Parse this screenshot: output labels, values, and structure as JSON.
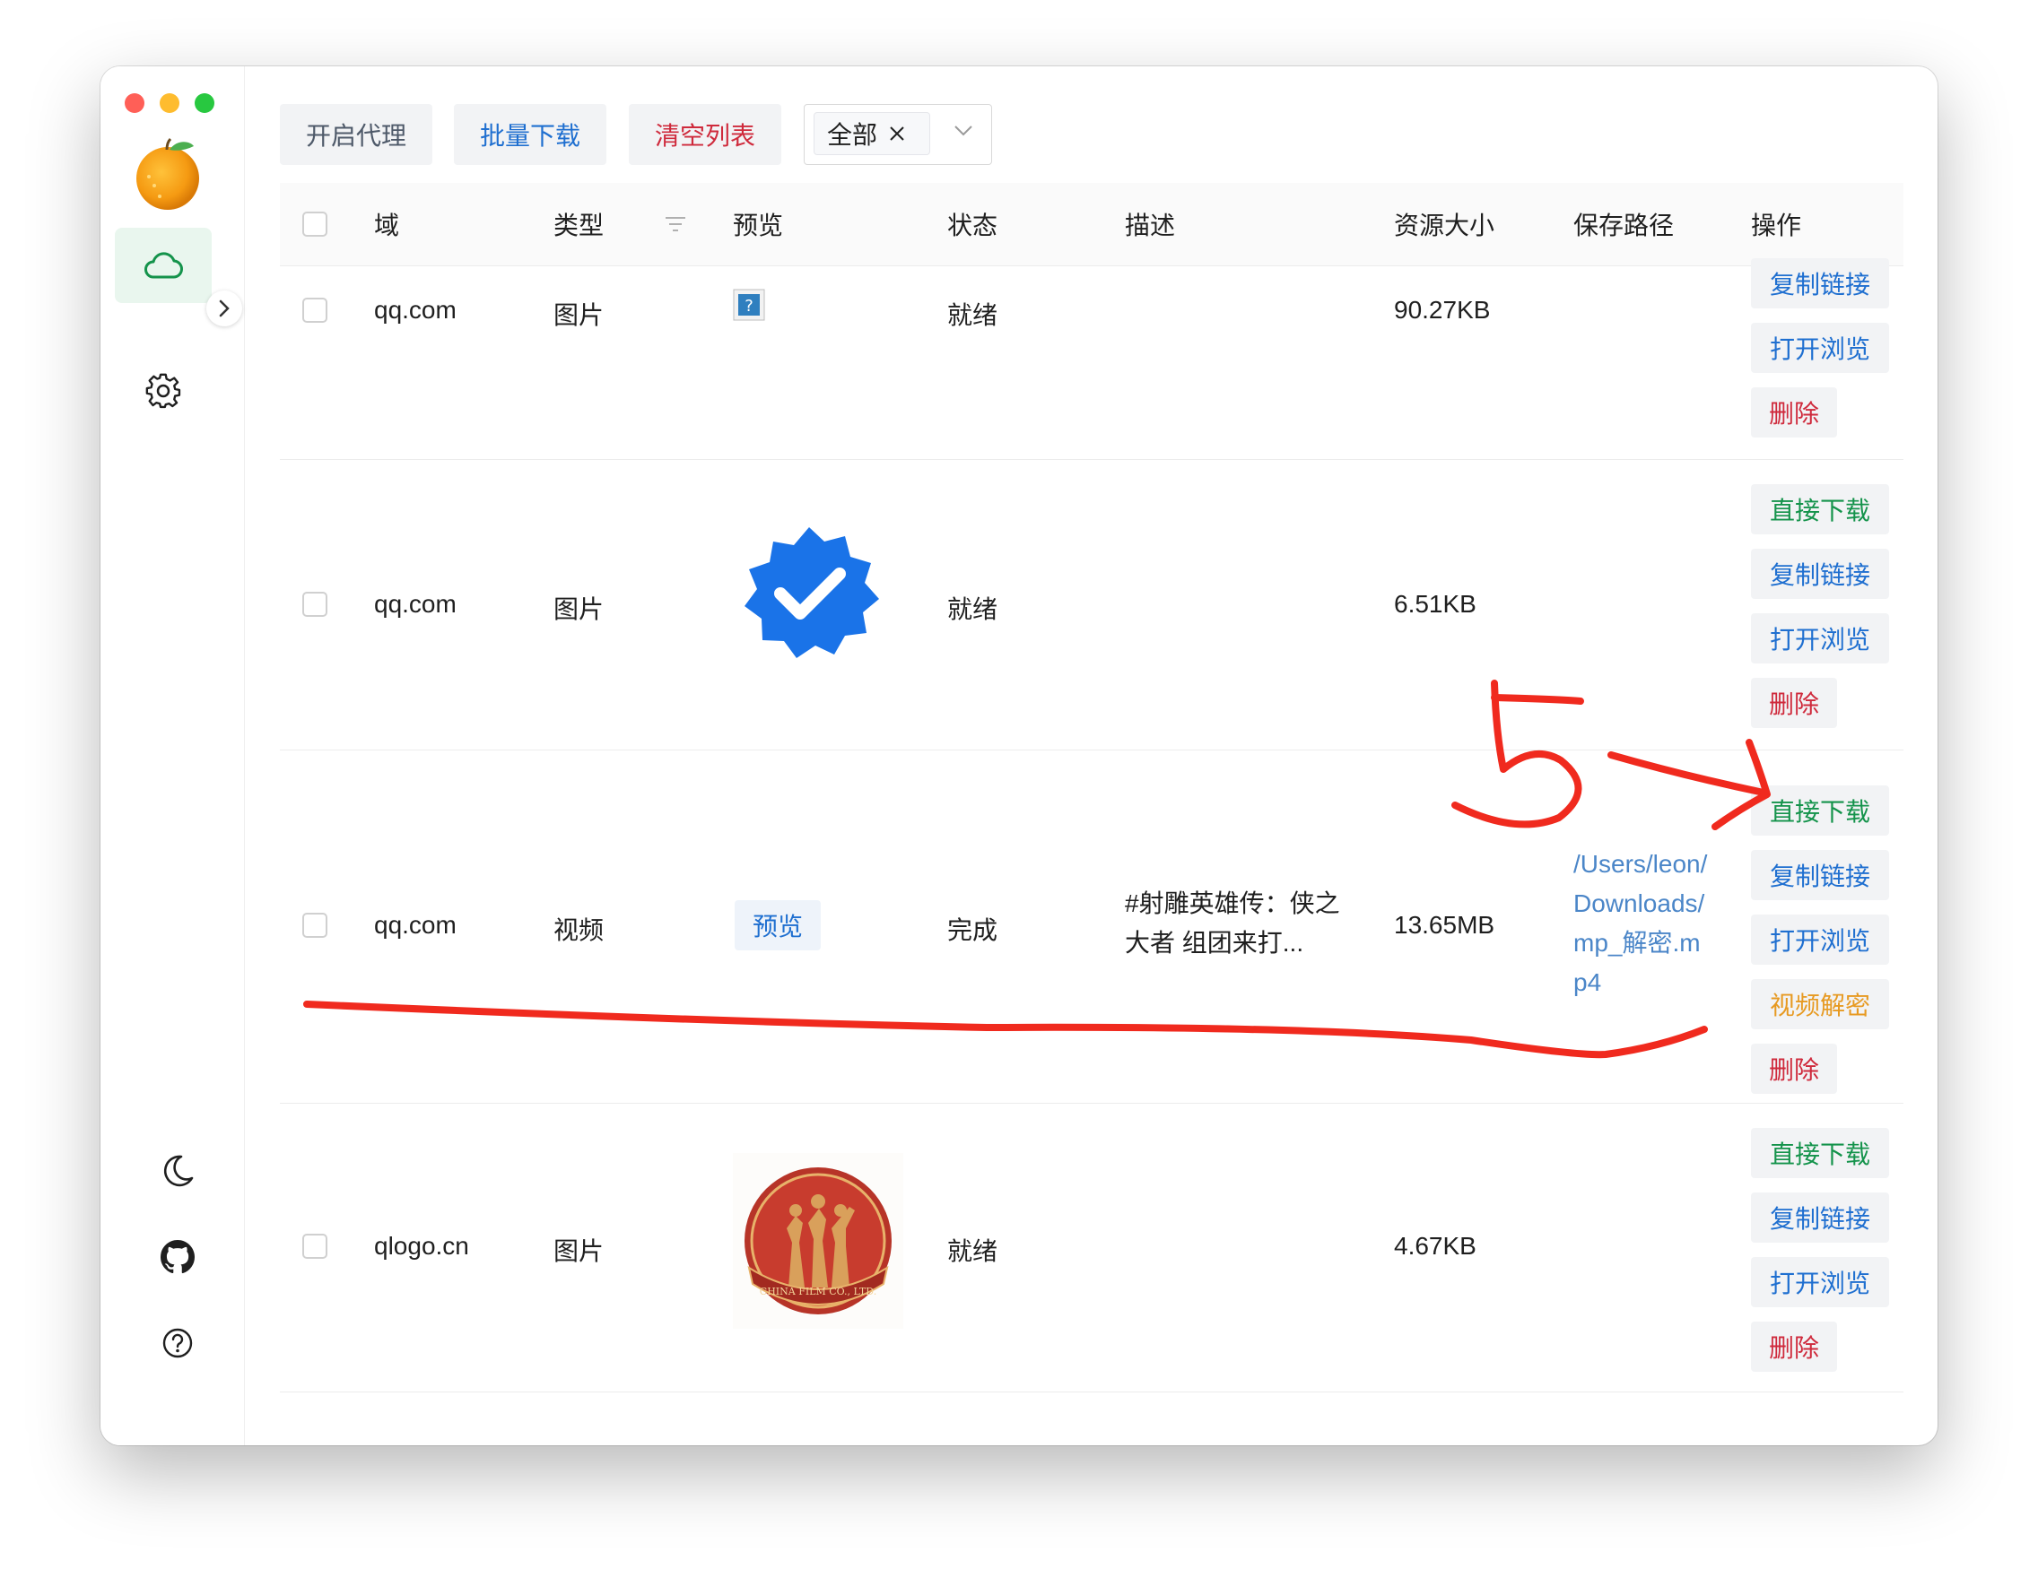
{
  "toolbar": {
    "proxy_label": "开启代理",
    "batch_download_label": "批量下载",
    "clear_list_label": "清空列表",
    "filter_tag": "全部"
  },
  "table": {
    "headers": {
      "domain": "域",
      "type": "类型",
      "preview": "预览",
      "status": "状态",
      "description": "描述",
      "size": "资源大小",
      "save_path": "保存路径",
      "actions": "操作"
    },
    "rows": [
      {
        "domain": "qq.com",
        "type": "图片",
        "preview": "broken-image-icon",
        "status": "就绪",
        "description": "",
        "size": "90.27KB",
        "save_path": "",
        "actions": [
          "复制链接",
          "打开浏览",
          "删除"
        ]
      },
      {
        "domain": "qq.com",
        "type": "图片",
        "preview": "verified-badge-image",
        "status": "就绪",
        "description": "",
        "size": "6.51KB",
        "save_path": "",
        "actions": [
          "直接下载",
          "复制链接",
          "打开浏览",
          "删除"
        ]
      },
      {
        "domain": "qq.com",
        "type": "视频",
        "preview_button": "预览",
        "status": "完成",
        "description": "#射雕英雄传：侠之大者 组团来打...",
        "size": "13.65MB",
        "save_path": "/Users/leon/Downloads/mp_解密.mp4",
        "actions": [
          "直接下载",
          "复制链接",
          "打开浏览",
          "视频解密",
          "删除"
        ]
      },
      {
        "domain": "qlogo.cn",
        "type": "图片",
        "preview": "china-film-logo-image",
        "status": "就绪",
        "description": "",
        "size": "4.67KB",
        "save_path": "",
        "actions": [
          "直接下载",
          "复制链接",
          "打开浏览",
          "删除"
        ]
      }
    ]
  },
  "logo_text": "CHINA FILM CO., LTD.",
  "annotation": {
    "number": "5",
    "color": "#f02a1e"
  },
  "colors": {
    "green": "#14934b",
    "blue": "#1f6fd0",
    "red": "#cf2a3c",
    "orange": "#e79a22",
    "active_bg": "#e9f6ee"
  }
}
